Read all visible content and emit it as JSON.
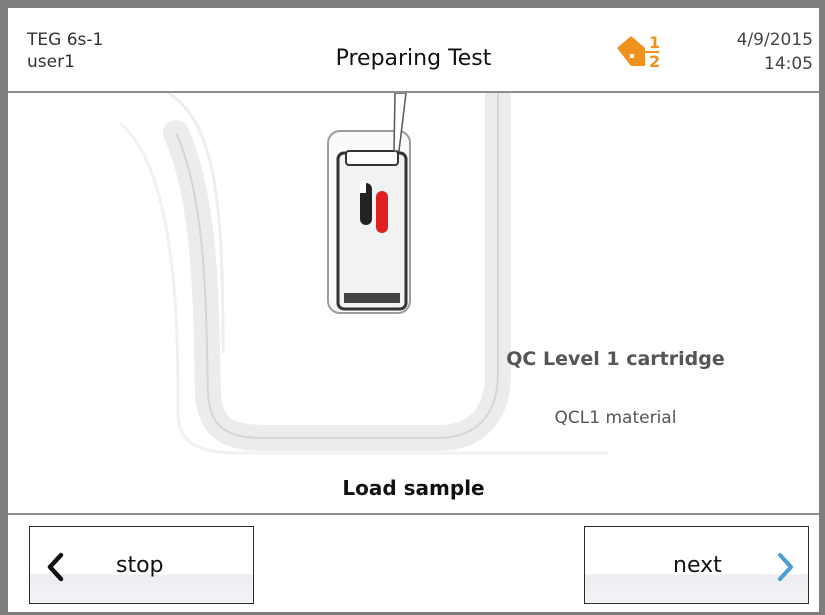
{
  "header": {
    "device_name": "TEG 6s-1",
    "user": "user1",
    "title": "Preparing Test",
    "date": "4/9/2015",
    "time": "14:05",
    "alert_icon": "warning-level-icon",
    "alert_color": "#f0921e"
  },
  "main": {
    "cartridge_label": "QC Level 1 cartridge",
    "material_label": "QCL1 material",
    "instruction": "Load sample"
  },
  "footer": {
    "stop_label": "stop",
    "next_label": "next",
    "stop_icon": "chevron-left-icon",
    "next_icon": "chevron-right-icon",
    "next_icon_color": "#4a9fd6"
  }
}
